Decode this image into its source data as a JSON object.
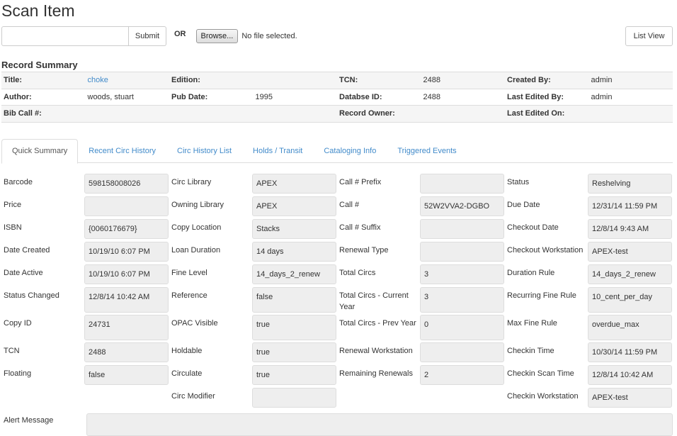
{
  "page_title": "Scan Item",
  "scan": {
    "barcode_value": "",
    "submit_label": "Submit",
    "or_label": "OR",
    "browse_label": "Browse...",
    "file_status": "No file selected.",
    "list_view_label": "List View"
  },
  "record_summary": {
    "heading": "Record Summary",
    "rows": [
      [
        {
          "label": "Title:",
          "value": "choke",
          "link": true
        },
        {
          "label": "Edition:",
          "value": ""
        },
        {
          "label": "TCN:",
          "value": "2488"
        },
        {
          "label": "Created By:",
          "value": "admin"
        }
      ],
      [
        {
          "label": "Author:",
          "value": "woods, stuart"
        },
        {
          "label": "Pub Date:",
          "value": "1995"
        },
        {
          "label": "Databse ID:",
          "value": "2488"
        },
        {
          "label": "Last Edited By:",
          "value": "admin"
        }
      ],
      [
        {
          "label": "Bib Call #:",
          "value": ""
        },
        {
          "label": "",
          "value": ""
        },
        {
          "label": "Record Owner:",
          "value": ""
        },
        {
          "label": "Last Edited On:",
          "value": ""
        }
      ]
    ]
  },
  "tabs": [
    {
      "label": "Quick Summary",
      "active": true
    },
    {
      "label": "Recent Circ History"
    },
    {
      "label": "Circ History List"
    },
    {
      "label": "Holds / Transit"
    },
    {
      "label": "Cataloging Info"
    },
    {
      "label": "Triggered Events"
    }
  ],
  "fields": [
    [
      {
        "label": "Barcode",
        "value": "598158008026"
      },
      {
        "label": "Circ Library",
        "value": "APEX"
      },
      {
        "label": "Call # Prefix",
        "value": ""
      },
      {
        "label": "Status",
        "value": "Reshelving"
      }
    ],
    [
      {
        "label": "Price",
        "value": ""
      },
      {
        "label": "Owning Library",
        "value": "APEX"
      },
      {
        "label": "Call #",
        "value": "52W2VVA2-DGBO"
      },
      {
        "label": "Due Date",
        "value": "12/31/14 11:59 PM"
      }
    ],
    [
      {
        "label": "ISBN",
        "value": "{0060176679}"
      },
      {
        "label": "Copy Location",
        "value": "Stacks"
      },
      {
        "label": "Call # Suffix",
        "value": ""
      },
      {
        "label": "Checkout Date",
        "value": "12/8/14 9:43 AM"
      }
    ],
    [
      {
        "label": "Date Created",
        "value": "10/19/10 6:07 PM"
      },
      {
        "label": "Loan Duration",
        "value": "14 days"
      },
      {
        "label": "Renewal Type",
        "value": ""
      },
      {
        "label": "Checkout Workstation",
        "value": "APEX-test"
      }
    ],
    [
      {
        "label": "Date Active",
        "value": "10/19/10 6:07 PM"
      },
      {
        "label": "Fine Level",
        "value": "14_days_2_renew"
      },
      {
        "label": "Total Circs",
        "value": "3"
      },
      {
        "label": "Duration Rule",
        "value": "14_days_2_renew"
      }
    ],
    [
      {
        "label": "Status Changed",
        "value": "12/8/14 10:42 AM"
      },
      {
        "label": "Reference",
        "value": "false"
      },
      {
        "label": "Total Circs - Current Year",
        "value": "3"
      },
      {
        "label": "Recurring Fine Rule",
        "value": "10_cent_per_day"
      }
    ],
    [
      {
        "label": "Copy ID",
        "value": "24731"
      },
      {
        "label": "OPAC Visible",
        "value": "true"
      },
      {
        "label": "Total Circs - Prev Year",
        "value": "0"
      },
      {
        "label": "Max Fine Rule",
        "value": "overdue_max"
      }
    ],
    [
      {
        "label": "TCN",
        "value": "2488"
      },
      {
        "label": "Holdable",
        "value": "true"
      },
      {
        "label": "Renewal Workstation",
        "value": ""
      },
      {
        "label": "Checkin Time",
        "value": "10/30/14 11:59 PM"
      }
    ],
    [
      {
        "label": "Floating",
        "value": "false"
      },
      {
        "label": "Circulate",
        "value": "true"
      },
      {
        "label": "Remaining Renewals",
        "value": "2"
      },
      {
        "label": "Checkin Scan Time",
        "value": "12/8/14 10:42 AM"
      }
    ],
    [
      {
        "label": "",
        "value": "",
        "empty": true
      },
      {
        "label": "Circ Modifier",
        "value": ""
      },
      {
        "label": "",
        "value": "",
        "empty": true
      },
      {
        "label": "Checkin Workstation",
        "value": "APEX-test"
      }
    ]
  ],
  "alert": {
    "label": "Alert Message",
    "value": ""
  }
}
